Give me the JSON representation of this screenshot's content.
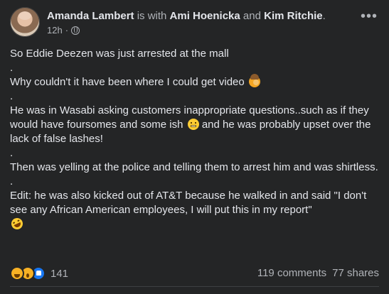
{
  "post": {
    "author": "Amanda Lambert",
    "with_text": " is with ",
    "tag1": "Ami Hoenicka",
    "and_text": " and ",
    "tag2": "Kim Ritchie",
    "end_punct": ".",
    "time": "12h",
    "time_sep": "·",
    "more_label": "•••",
    "lines": [
      "So Eddie Deezen was just arrested at the mall",
      ".",
      "Why couldn't it have been where I could get video",
      ".",
      "He was in Wasabi asking customers inappropriate questions..such as if they would have foursomes and some ish",
      "and he was probably upset over the lack of false lashes!",
      ".",
      "Then was yelling at the police and telling them to arrest him and was shirtless.",
      ".",
      "Edit: he was also kicked out of AT&T because he walked in and said \"I don't see any African American employees, I will put this in my report\""
    ],
    "emoji": [
      "facepalm-emoji",
      "grimace-emoji",
      "rofl-emoji"
    ],
    "reactions": {
      "icons": [
        "haha-reaction-icon",
        "wow-reaction-icon",
        "like-reaction-icon"
      ],
      "count": "141"
    },
    "comments": "119 comments",
    "shares": "77 shares"
  },
  "colors": {
    "background": "#242526",
    "text": "#e4e6eb",
    "muted": "#b0b3b8",
    "like_blue": "#1877f2",
    "reaction_yellow": "#f7b125"
  }
}
